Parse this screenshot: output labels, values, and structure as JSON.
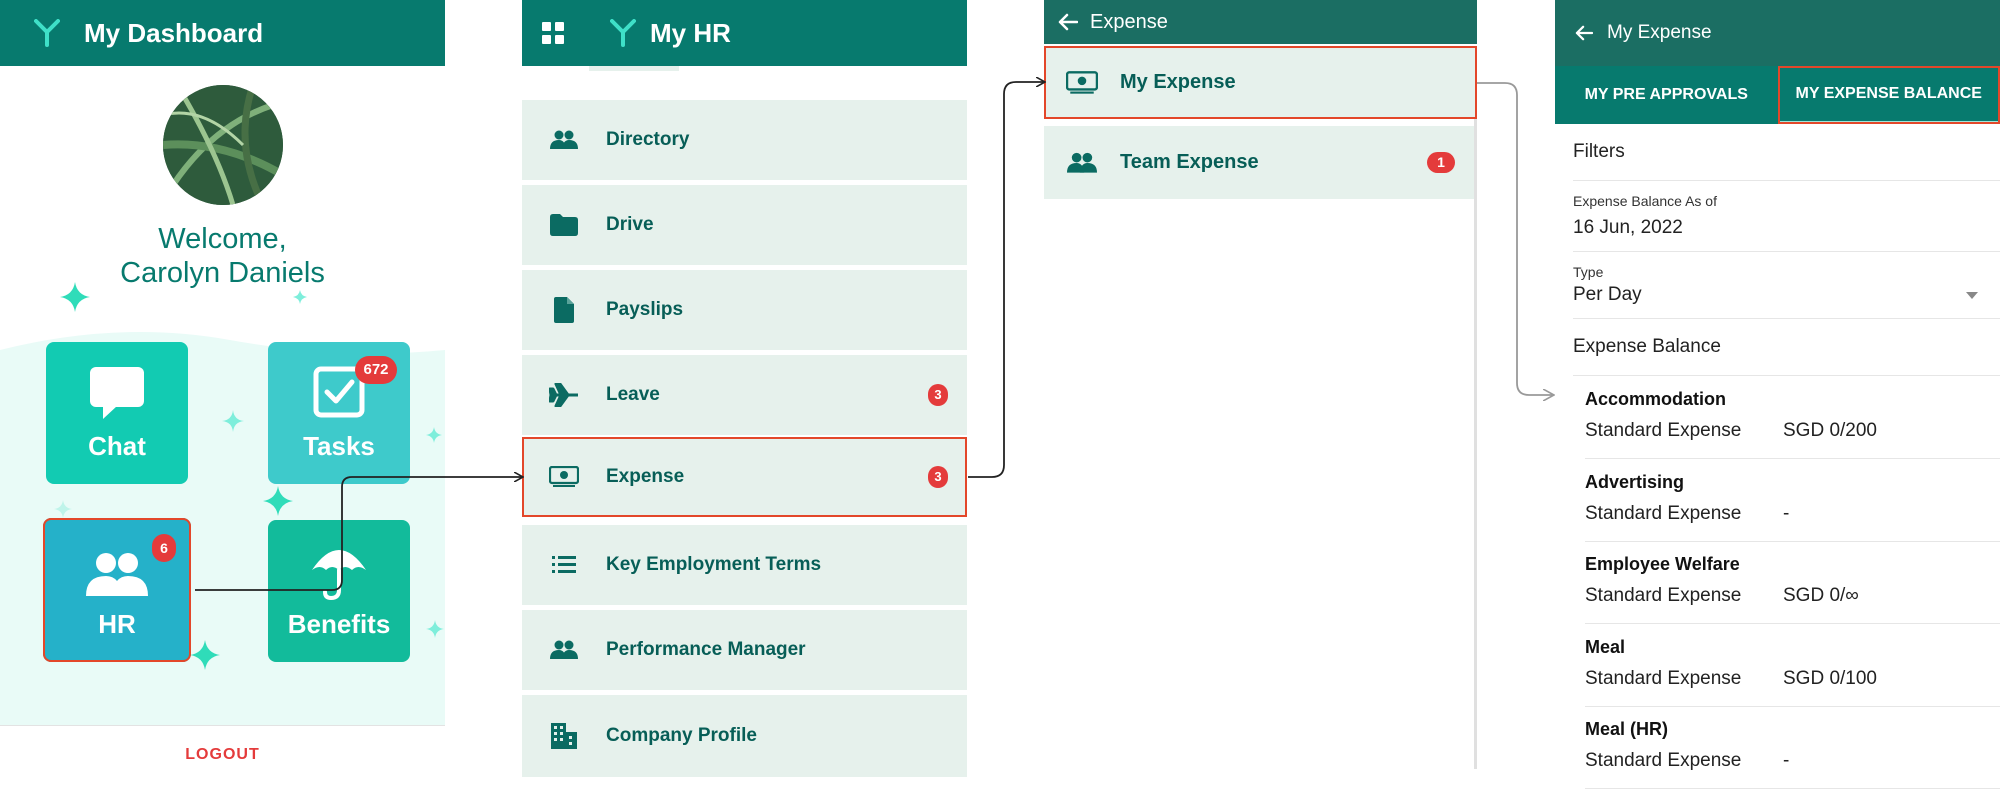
{
  "dashboard": {
    "title": "My Dashboard",
    "welcome_line1": "Welcome,",
    "welcome_line2": "Carolyn Daniels",
    "tiles": [
      {
        "label": "Chat",
        "icon": "chat-bubble-icon"
      },
      {
        "label": "Tasks",
        "icon": "checkbox-icon",
        "badge": "672"
      },
      {
        "label": "HR",
        "icon": "people-icon",
        "badge": "6"
      },
      {
        "label": "Benefits",
        "icon": "umbrella-icon"
      }
    ],
    "logout": "LOGOUT"
  },
  "my_hr": {
    "title": "My HR",
    "items": [
      {
        "label": "Directory",
        "icon": "people-icon"
      },
      {
        "label": "Drive",
        "icon": "folder-icon"
      },
      {
        "label": "Payslips",
        "icon": "document-icon"
      },
      {
        "label": "Leave",
        "icon": "airplane-icon",
        "badge": "3"
      },
      {
        "label": "Expense",
        "icon": "money-icon",
        "badge": "3"
      },
      {
        "label": "Key Employment Terms",
        "icon": "list-icon"
      },
      {
        "label": "Performance Manager",
        "icon": "people-icon"
      },
      {
        "label": "Company Profile",
        "icon": "building-icon"
      }
    ]
  },
  "expense": {
    "title": "Expense",
    "items": [
      {
        "label": "My Expense",
        "icon": "money-icon"
      },
      {
        "label": "Team Expense",
        "icon": "people-icon",
        "badge": "1"
      }
    ]
  },
  "my_expense": {
    "title": "My Expense",
    "tabs": [
      "MY PRE APPROVALS",
      "MY EXPENSE BALANCE"
    ],
    "filters_label": "Filters",
    "balance_as_of_label": "Expense Balance As of",
    "balance_as_of_value": "16 Jun, 2022",
    "type_label": "Type",
    "type_value": "Per Day",
    "section_title": "Expense Balance",
    "categories": [
      {
        "name": "Accommodation",
        "label": "Standard Expense",
        "value": "SGD 0/200"
      },
      {
        "name": "Advertising",
        "label": "Standard Expense",
        "value": "-"
      },
      {
        "name": "Employee Welfare",
        "label": "Standard Expense",
        "value": "SGD 0/∞"
      },
      {
        "name": "Meal",
        "label": "Standard Expense",
        "value": "SGD 0/100"
      },
      {
        "name": "Meal (HR)",
        "label": "Standard Expense",
        "value": "-"
      }
    ]
  },
  "colors": {
    "header": "#077a6e",
    "header_dark": "#1b6e63",
    "accent_text": "#075e57",
    "menu_bg": "#e6f1ec",
    "badge": "#e43b3b",
    "highlight": "#e3472a",
    "tile_chat": "#12cbb2",
    "tile_tasks": "#3ecacb",
    "tile_hr": "#25b1c9",
    "tile_benefits": "#12bb9b"
  }
}
